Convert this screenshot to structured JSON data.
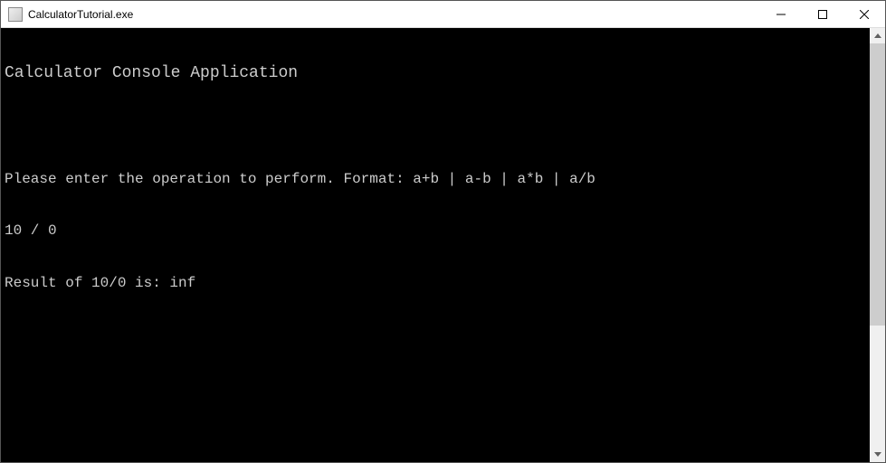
{
  "window": {
    "title": "CalculatorTutorial.exe"
  },
  "console": {
    "lines": [
      "Calculator Console Application",
      "",
      "Please enter the operation to perform. Format: a+b | a-b | a*b | a/b",
      "10 / 0",
      "Result of 10/0 is: inf"
    ]
  }
}
